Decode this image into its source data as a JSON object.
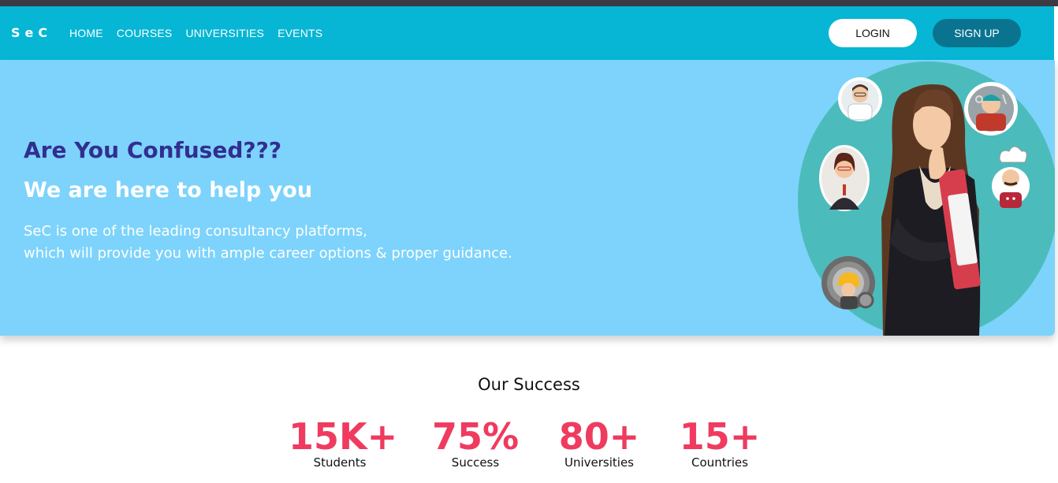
{
  "brand": {
    "name": "SeC"
  },
  "nav": {
    "links": [
      "HOME",
      "COURSES",
      "UNIVERSITIES",
      "EVENTS"
    ],
    "login_label": "LOGIN",
    "signup_label": "SIGN UP"
  },
  "hero": {
    "heading": "Are You Confused???",
    "subheading": "We are here to help you",
    "description_line1": "SeC is one of the leading consultancy platforms,",
    "description_line2": "which will provide you with ample career options & proper guidance.",
    "illustration_icons": [
      "doctor-avatar-icon",
      "mechanic-avatar-icon",
      "businesswoman-avatar-icon",
      "chef-avatar-icon",
      "engineer-gear-icon",
      "thinking-student-illustration"
    ]
  },
  "success": {
    "title": "Our Success",
    "stats": [
      {
        "value": "15K+",
        "label": "Students"
      },
      {
        "value": "75%",
        "label": "Success"
      },
      {
        "value": "80+",
        "label": "Universities"
      },
      {
        "value": "15+",
        "label": "Countries"
      }
    ]
  },
  "colors": {
    "navbar": "#06b6d4",
    "hero_bg": "#7dd3fb",
    "heading": "#312e91",
    "stat_value": "#ef3b5f",
    "signup_bg": "#0a7490"
  }
}
